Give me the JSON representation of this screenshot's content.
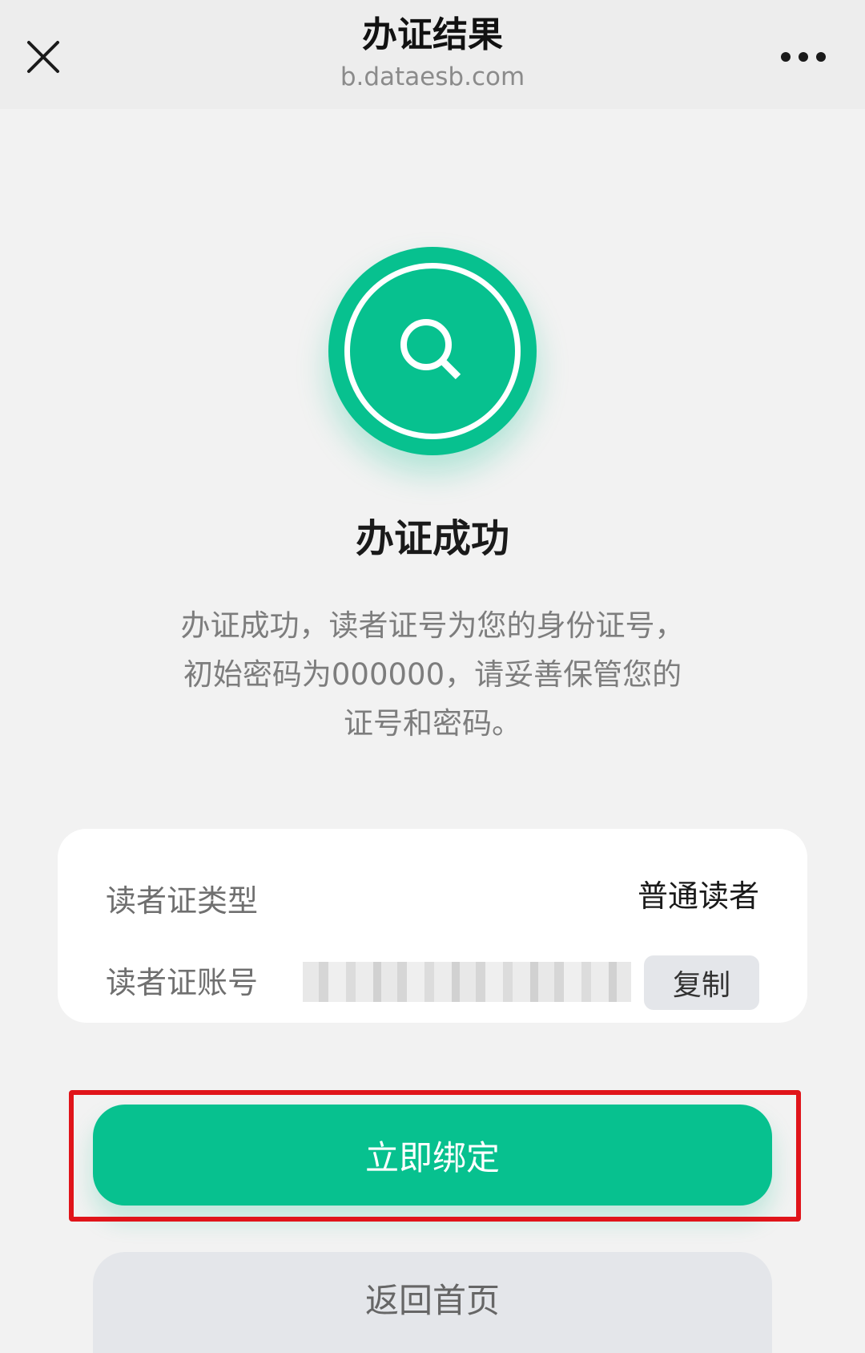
{
  "header": {
    "title": "办证结果",
    "url": "b.dataesb.com",
    "close_icon": "close-icon",
    "more_icon": "more-icon"
  },
  "result": {
    "icon": "search-icon",
    "accent_color": "#07c18f",
    "title": "办证成功",
    "description_lines": [
      "办证成功，读者证号为您的身份证号，",
      "初始密码为000000，请妥善保管您的",
      "证号和密码。"
    ]
  },
  "card": {
    "type_label": "读者证类型",
    "type_value": "普通读者",
    "account_label": "读者证账号",
    "copy_label": "复制"
  },
  "actions": {
    "bind_label": "立即绑定",
    "home_label": "返回首页",
    "highlight_color": "#e0141a"
  }
}
